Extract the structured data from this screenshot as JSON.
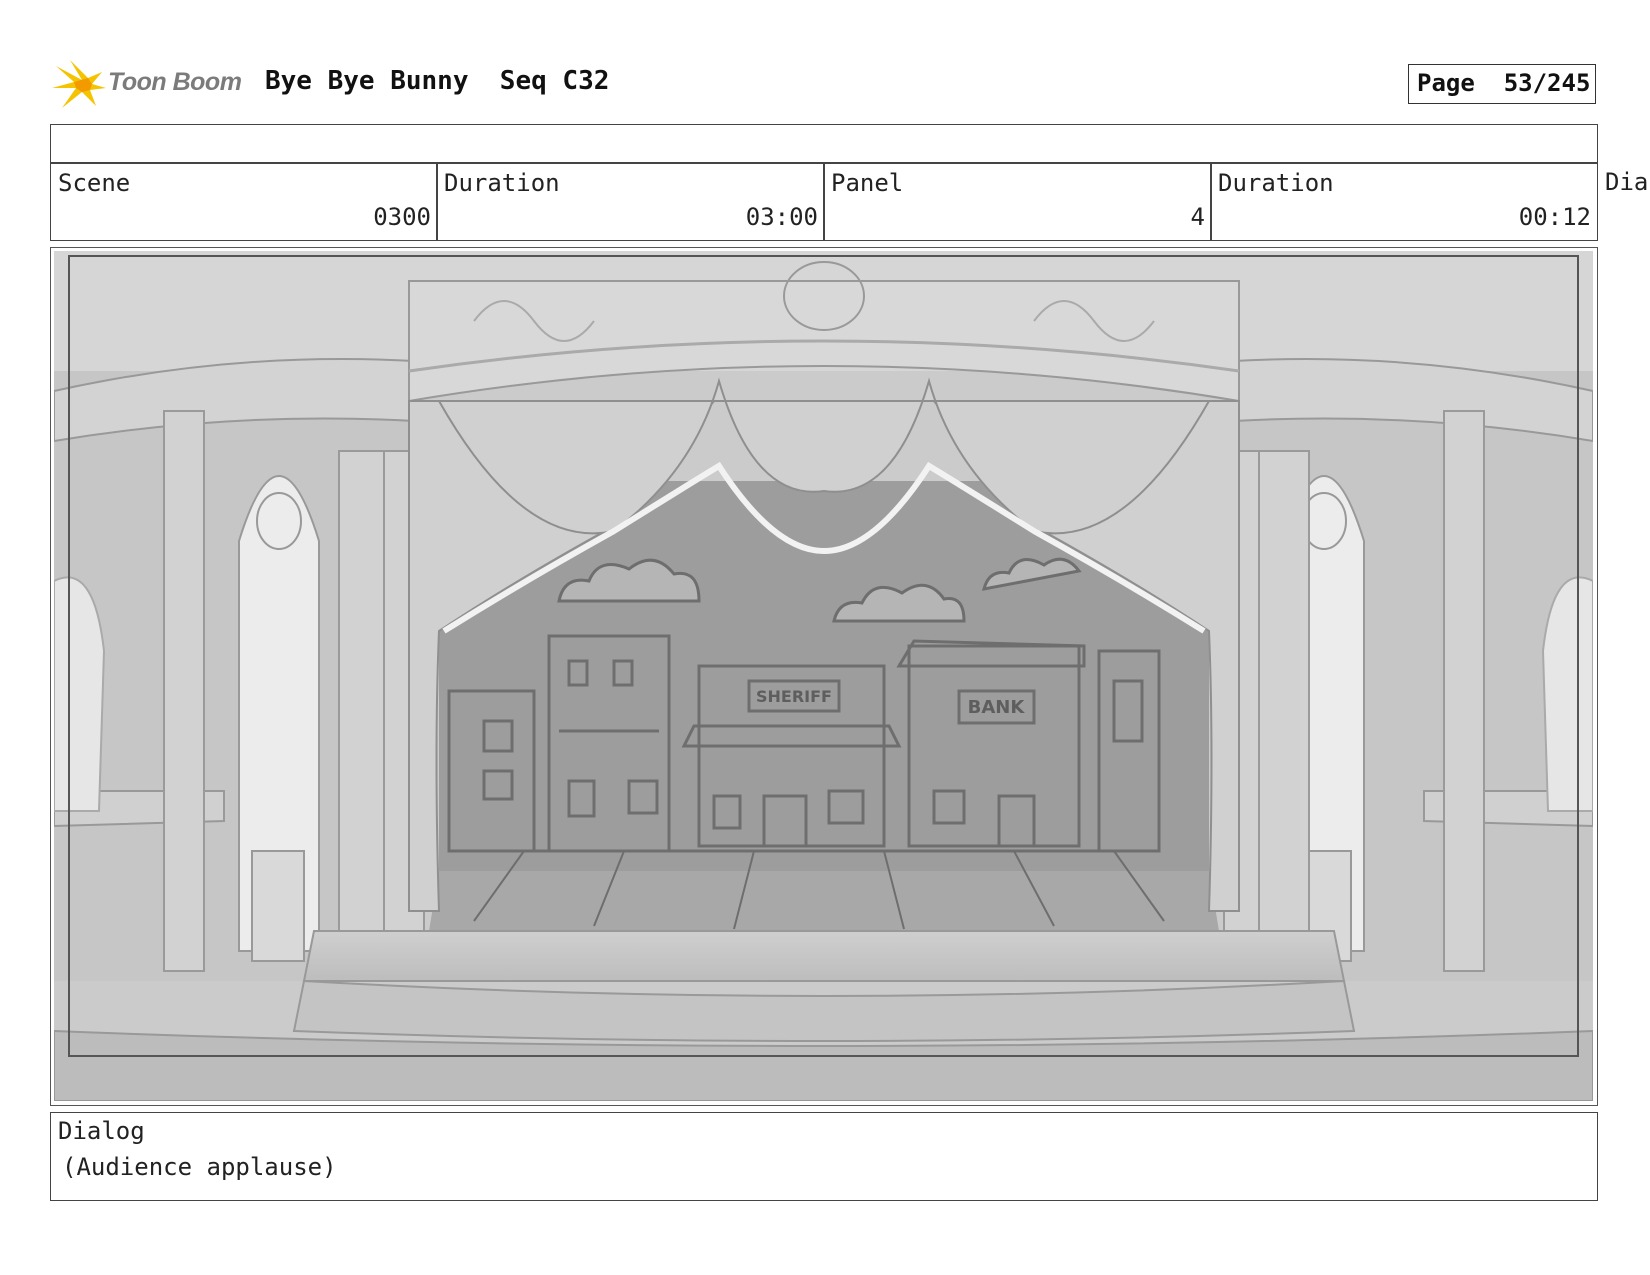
{
  "header": {
    "logo_text": "Toon Boom",
    "title": "Bye Bye Bunny  Seq C32",
    "page_label": "Page  53/245"
  },
  "info": {
    "scene_label": "Scene",
    "scene_value": "0300",
    "scene_duration_label": "Duration",
    "scene_duration_value": "03:00",
    "panel_label": "Panel",
    "panel_value": "4",
    "panel_duration_label": "Duration",
    "panel_duration_value": "00:12",
    "overflow_label": "Dia"
  },
  "artwork": {
    "sign_sheriff": "SHERIFF",
    "sign_bank": "BANK"
  },
  "dialog": {
    "label": "Dialog",
    "text": "(Audience applause)"
  },
  "colors": {
    "logo_yellow": "#f5c400",
    "logo_orange": "#f29a00",
    "sketch_gray": "#a9a9a9",
    "backdrop_gray": "#9a9a9a"
  }
}
